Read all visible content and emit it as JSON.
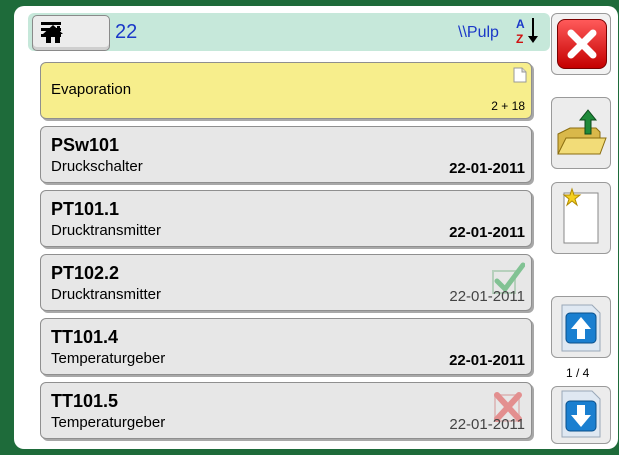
{
  "header": {
    "count": "22",
    "path": "\\\\Pulp",
    "sort_icon": "sort-az-icon"
  },
  "items": [
    {
      "title": "Evaporation",
      "badge": "2 + 18",
      "type": "folder"
    },
    {
      "title": "PSw101",
      "subtitle": "Druckschalter",
      "date": "22-01-2011"
    },
    {
      "title": "PT101.1",
      "subtitle": "Drucktransmitter",
      "date": "22-01-2011"
    },
    {
      "title": "PT102.2",
      "subtitle": "Drucktransmitter",
      "date": "22-01-2011",
      "status": "checkmark-icon"
    },
    {
      "title": "TT101.4",
      "subtitle": "Temperaturgeber",
      "date": "22-01-2011"
    },
    {
      "title": "TT101.5",
      "subtitle": "Temperaturgeber",
      "date": "22-01-2011",
      "status": "x-mark-icon"
    }
  ],
  "sidebar": {
    "page_indicator": "1 / 4"
  },
  "colors": {
    "background": "#1e6b3a",
    "header": "#c6e8da",
    "folder_item": "#f7ee8c",
    "item": "#e7e7e7",
    "accent_blue": "#1a38c8",
    "close_red": "#e01010"
  }
}
